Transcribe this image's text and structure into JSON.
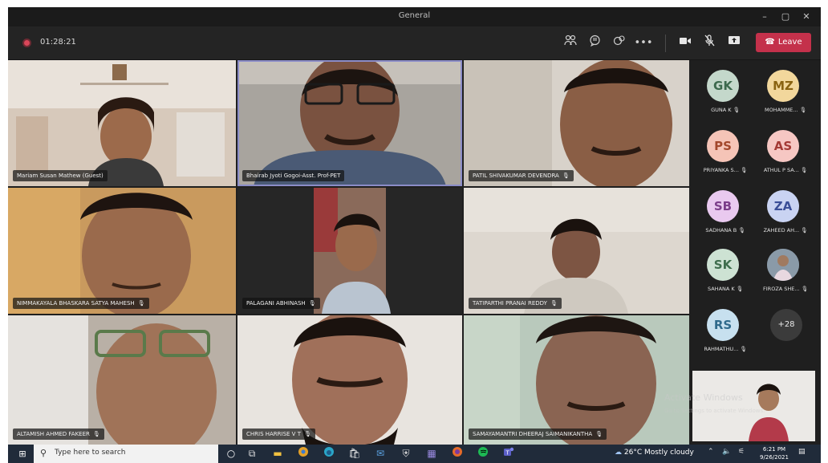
{
  "window": {
    "title": "General"
  },
  "window_controls": {
    "minimize": "–",
    "maximize": "▢",
    "close": "✕"
  },
  "meeting": {
    "timer": "01:28:21",
    "leave_label": "Leave"
  },
  "toolbar_icons": {
    "participants": "participants-icon",
    "chat": "chat-icon",
    "reactions": "reactions-icon",
    "more": "more-options-icon",
    "camera": "camera-icon",
    "mic": "mic-muted-icon",
    "share": "share-screen-icon"
  },
  "tiles": [
    {
      "name": "Mariam Susan Mathew (Guest)",
      "muted": false
    },
    {
      "name": "Bhairab Jyoti Gogoi-Asst. Prof-PET",
      "muted": false
    },
    {
      "name": "PATIL SHIVAKUMAR DEVENDRA",
      "muted": true
    },
    {
      "name": "NIMMAKAYALA BHASKARA SATYA MAHESH",
      "muted": true
    },
    {
      "name": "PALAGANI ABHINASH",
      "muted": true
    },
    {
      "name": "TATIPARTHI PRANAI REDDY",
      "muted": true
    },
    {
      "name": "ALTAMISH AHMED FAKEER",
      "muted": true
    },
    {
      "name": "CHRIS HARRISE V T",
      "muted": true
    },
    {
      "name": "SAMAYAMANTRI DHEERAJ SAIMANIKANTHA",
      "muted": true
    }
  ],
  "participants": [
    {
      "initials": "GK",
      "name": "GUNA K",
      "bg": "#c4d8cb",
      "fg": "#3d6a4e"
    },
    {
      "initials": "MZ",
      "name": "MOHAMME...",
      "bg": "#f2d79c",
      "fg": "#8a6312"
    },
    {
      "initials": "PS",
      "name": "PRIYANKA S...",
      "bg": "#f5c4b7",
      "fg": "#a3482c"
    },
    {
      "initials": "AS",
      "name": "ATHUL P SA...",
      "bg": "#f6c7c3",
      "fg": "#a43a35"
    },
    {
      "initials": "SB",
      "name": "SADHANA B",
      "bg": "#e9c9ef",
      "fg": "#7c3e8a"
    },
    {
      "initials": "ZA",
      "name": "ZAHEED AH...",
      "bg": "#c9d3f2",
      "fg": "#3b4f98"
    },
    {
      "initials": "SK",
      "name": "SAHANA K",
      "bg": "#cde2d3",
      "fg": "#3f6e4e"
    },
    {
      "initials": "",
      "name": "FIROZA SHE...",
      "bg": "#7a8a9a",
      "fg": "#ffffff"
    },
    {
      "initials": "RS",
      "name": "RAHMATHU...",
      "bg": "#c7e0ef",
      "fg": "#2f6a8c"
    }
  ],
  "more_participants": "+28",
  "watermark": {
    "line1": "Activate Windows",
    "line2": "Go to Settings to activate Windows."
  },
  "taskbar": {
    "search_placeholder": "Type here to search",
    "weather": "26°C  Mostly cloudy",
    "time": "6:21 PM",
    "date": "9/26/2021"
  }
}
